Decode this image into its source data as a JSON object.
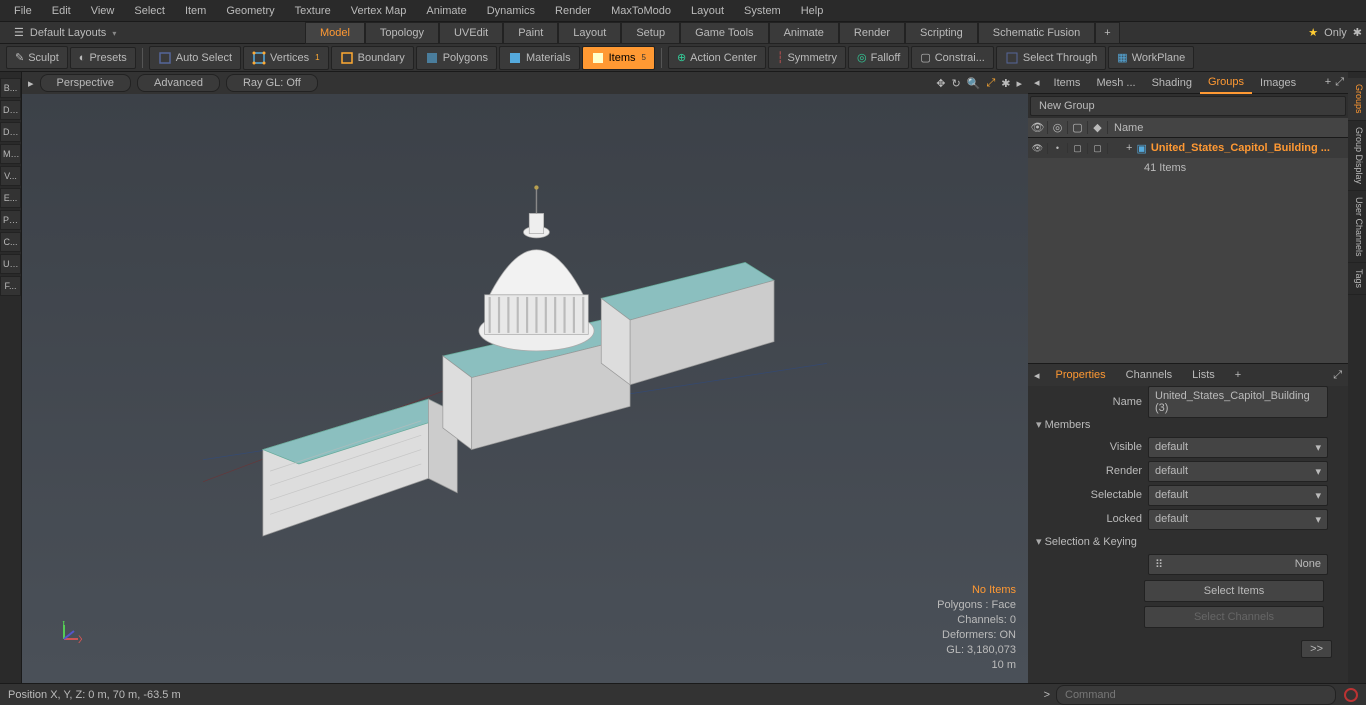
{
  "menubar": [
    "File",
    "Edit",
    "View",
    "Select",
    "Item",
    "Geometry",
    "Texture",
    "Vertex Map",
    "Animate",
    "Dynamics",
    "Render",
    "MaxToModo",
    "Layout",
    "System",
    "Help"
  ],
  "layout": {
    "default": "Default Layouts",
    "only": "Only"
  },
  "modetabs": [
    "Model",
    "Topology",
    "UVEdit",
    "Paint",
    "Layout",
    "Setup",
    "Game Tools",
    "Animate",
    "Render",
    "Scripting",
    "Schematic Fusion"
  ],
  "modetabs_active": 0,
  "toolbar": {
    "sculpt": "Sculpt",
    "presets": "Presets",
    "autoselect": "Auto Select",
    "vertices": "Vertices",
    "boundary": "Boundary",
    "polygons": "Polygons",
    "materials": "Materials",
    "items": "Items",
    "actioncenter": "Action Center",
    "symmetry": "Symmetry",
    "falloff": "Falloff",
    "constrain": "Constrai...",
    "selectthrough": "Select Through",
    "workplane": "WorkPlane"
  },
  "leftstrip": [
    "B...",
    "De...",
    "Dup...",
    "Mes...",
    "V...",
    "E...",
    "Pol...",
    "C...",
    "UV...",
    "F..."
  ],
  "viewhdr": {
    "perspective": "Perspective",
    "advanced": "Advanced",
    "raygl": "Ray GL: Off"
  },
  "vpinfo": {
    "noitems": "No Items",
    "polys": "Polygons : Face",
    "channels": "Channels: 0",
    "deformers": "Deformers: ON",
    "gl": "GL: 3,180,073",
    "scale": "10 m"
  },
  "righttabs": [
    "Items",
    "Mesh ...",
    "Shading",
    "Groups",
    "Images"
  ],
  "righttabs_active": 3,
  "newgroup": "New Group",
  "treehdr": {
    "name": "Name"
  },
  "tree": {
    "item": "United_States_Capitol_Building ...",
    "sub": "41 Items"
  },
  "proptabs": [
    "Properties",
    "Channels",
    "Lists"
  ],
  "proptabs_active": 0,
  "props": {
    "name_lbl": "Name",
    "name_val": "United_States_Capitol_Building (3)",
    "members": "Members",
    "visible_lbl": "Visible",
    "visible_val": "default",
    "render_lbl": "Render",
    "render_val": "default",
    "selectable_lbl": "Selectable",
    "selectable_val": "default",
    "locked_lbl": "Locked",
    "locked_val": "default",
    "selkey": "Selection & Keying",
    "none": "None",
    "selitems": "Select Items",
    "selchan": "Select Channels",
    "arrow": ">>"
  },
  "sidetabs": [
    "Groups",
    "Group Display",
    "User Channels",
    "Tags"
  ],
  "sidetabs_active": 0,
  "status": {
    "pos": "Position X, Y, Z:   0 m, 70 m, -63.5 m",
    "cmd": "Command",
    "prompt": ">"
  },
  "colors": {
    "accent": "#ff9933",
    "teal": "#8bbfbf"
  }
}
